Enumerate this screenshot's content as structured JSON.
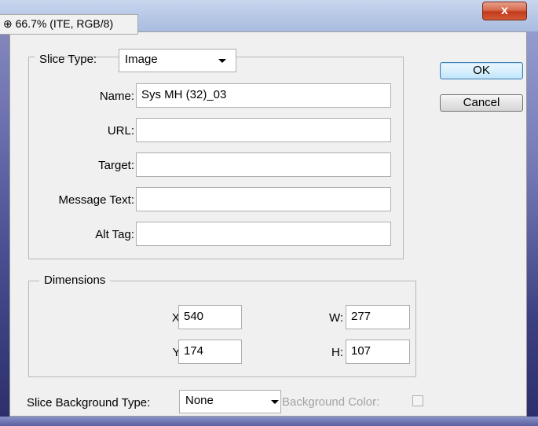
{
  "window": {
    "title_fragment": "⊕ 66.7% (ITE, RGB/8)",
    "close_symbol": "x"
  },
  "buttons": {
    "ok": "OK",
    "cancel": "Cancel"
  },
  "slice_group": {
    "slice_type_label": "Slice Type:",
    "slice_type_value": "Image",
    "fields": [
      {
        "label": "Name:",
        "value": "Sys MH (32)_03"
      },
      {
        "label": "URL:",
        "value": ""
      },
      {
        "label": "Target:",
        "value": ""
      },
      {
        "label": "Message Text:",
        "value": ""
      },
      {
        "label": "Alt Tag:",
        "value": ""
      }
    ]
  },
  "dimensions": {
    "legend": "Dimensions",
    "x_label": "X:",
    "x_value": "540",
    "y_label": "Y:",
    "y_value": "174",
    "w_label": "W:",
    "w_value": "277",
    "h_label": "H:",
    "h_value": "107"
  },
  "background": {
    "type_label": "Slice Background Type:",
    "type_value": "None",
    "color_label": "Background Color:"
  },
  "colors": {
    "dialog_bg": "#f0f0f0",
    "close_red": "#c2391c",
    "default_btn_border": "#3c7fb1"
  }
}
